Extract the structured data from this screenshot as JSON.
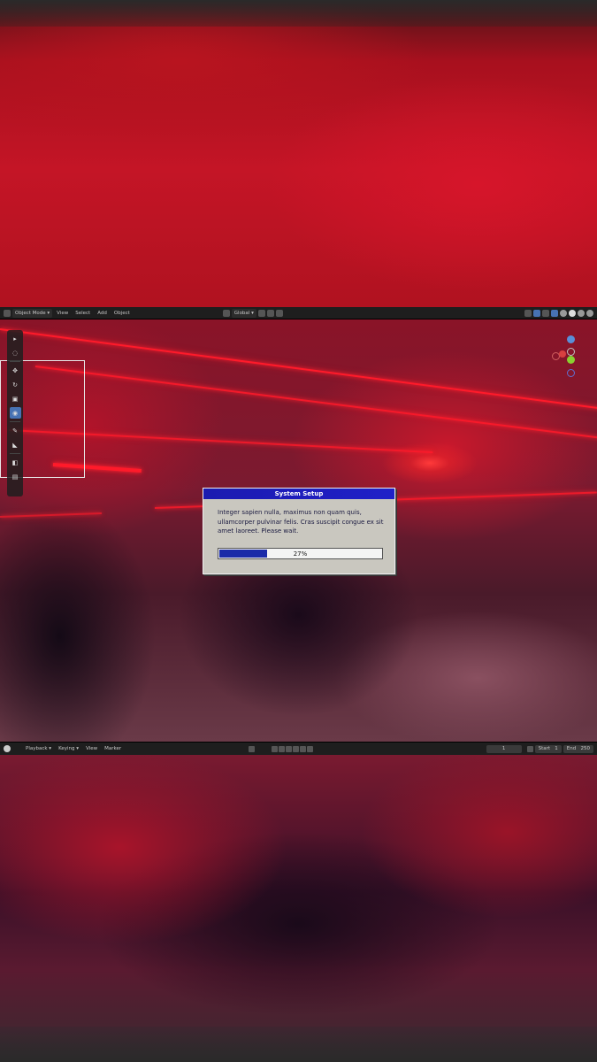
{
  "header": {
    "mode_label": "Object Mode",
    "menus": [
      "View",
      "Select",
      "Add",
      "Object"
    ],
    "orientation_label": "Global"
  },
  "toolbar": {
    "tools": [
      "cursor-icon",
      "select-box-icon",
      "move-icon",
      "rotate-icon",
      "scale-icon",
      "transform-icon",
      "annotate-icon",
      "measure-icon",
      "add-cube-icon",
      "camera-icon"
    ]
  },
  "dialog": {
    "title": "System Setup",
    "message": "Integer sapien nulla, maximus non quam quis, ullamcorper pulvinar felis. Cras suscipit congue ex sit amet laoreet. Please wait.",
    "progress_percent": 27,
    "progress_label": "27%"
  },
  "timeline": {
    "menus": [
      "Playback",
      "Keying",
      "View",
      "Marker"
    ],
    "current_frame": "1",
    "start_label": "Start",
    "start_value": "1",
    "end_label": "End",
    "end_value": "250"
  },
  "colors": {
    "accent": "#4772b3",
    "dialog_title": "#1b1bb0",
    "progress_fill": "#1b2ba8"
  }
}
